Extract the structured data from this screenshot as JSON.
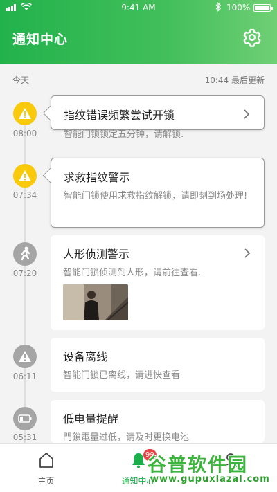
{
  "status_bar": {
    "time": "9:41 AM",
    "battery": "100%",
    "battery_level": 1.0
  },
  "header": {
    "title": "通知中心",
    "settings_icon": "gear-icon"
  },
  "section": {
    "label": "今天",
    "updated": "10:44 最后更新"
  },
  "notifications": [
    {
      "icon": "warning-icon",
      "time": "08:00",
      "title": "指纹错误频繁尝试开锁",
      "desc": "智能门锁锁定五分钟，请解锁.",
      "has_arrow": true
    },
    {
      "icon": "warning-icon",
      "time": "07:34",
      "title": "求救指纹警示",
      "desc": "智能门锁使用求救指纹解锁，请即刻到场处理!",
      "has_arrow": false
    },
    {
      "icon": "person-walking-icon",
      "time": "07:20",
      "title": "人形侦测警示",
      "desc": "智能门锁侦测到人形，请前往查看.",
      "has_arrow": true,
      "has_image": true
    },
    {
      "icon": "warning-icon",
      "time": "06:11",
      "title": "设备离线",
      "desc": "智能门锁已离线，请进快查看",
      "has_arrow": false
    },
    {
      "icon": "battery-low-icon",
      "time": "05:31",
      "title": "低电量提醒",
      "desc": "門鎖電量过低，请及时更换电池",
      "has_arrow": false
    }
  ],
  "tabs": [
    {
      "label": "主页",
      "icon": "home-icon",
      "active": false
    },
    {
      "label": "通知中心",
      "icon": "bell-icon",
      "active": true,
      "badge": "99"
    },
    {
      "label": "",
      "icon": "profile-icon",
      "active": false
    }
  ],
  "watermark": {
    "logo": "谷普软件园",
    "url": "www.gupuxlazal.com"
  },
  "colors": {
    "brand_green": "#22b24c",
    "warning_yellow": "#f9c90c",
    "badge_red": "#e64545",
    "icon_grey": "#a5a5a5"
  }
}
